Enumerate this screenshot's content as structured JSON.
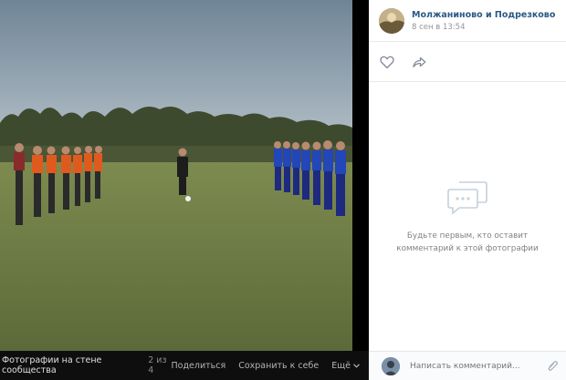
{
  "photo": {
    "alt_icon": "photo-image"
  },
  "footer": {
    "title": "Фотографии на стене сообщества",
    "counter": "2 из 4",
    "share_label": "Поделиться",
    "save_label": "Сохранить к себе",
    "more_label": "Ещё"
  },
  "post": {
    "author": "Молжаниново и Подрезково",
    "date": "8 сен в 13:54"
  },
  "actions": {
    "like_icon": "heart-icon",
    "share_icon": "share-arrow-icon"
  },
  "comments": {
    "empty_text": "Будьте первым, кто оставит комментарий к этой фотографии"
  },
  "composer": {
    "placeholder": "Написать комментарий..."
  },
  "colors": {
    "link": "#2a5885",
    "muted": "#939393",
    "panel_bg": "#ffffff",
    "viewer_bg": "#000000"
  }
}
